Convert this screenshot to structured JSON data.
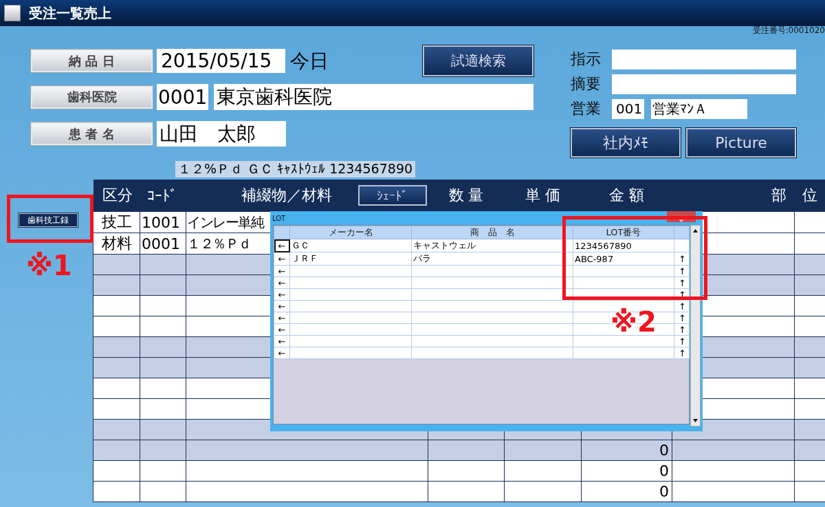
{
  "title_bar": {
    "title": "受注一覧売上",
    "order_number": "受注番号:0001020"
  },
  "form": {
    "delivery_date": {
      "label": "納 品 日",
      "value": "2015/05/15",
      "today": "今日"
    },
    "clinic": {
      "label": "歯科医院",
      "code": "0001",
      "name": "東京歯科医院"
    },
    "patient": {
      "label": "患 者 名",
      "name": "山田　太郎"
    },
    "fitting_search_button": "試適検索",
    "instruction": {
      "label": "指示"
    },
    "summary": {
      "label": "摘要"
    },
    "sales": {
      "label": "営業",
      "code": "001",
      "name": "営業ﾏﾝＡ"
    },
    "buttons": [
      "社内ﾒﾓ",
      "Picture"
    ],
    "info_line": "１２%Ｐｄ ＧＣ ｷｬｽﾄｳｪﾙ 1234567890"
  },
  "side_button": "歯科技工録",
  "table": {
    "columns": [
      "区分",
      "ｺｰﾄﾞ",
      "補綴物／材料",
      "数 量",
      "単 価",
      "金 額",
      "部",
      "位"
    ],
    "shade_button": "ｼｪｰﾄﾞ",
    "rows": [
      {
        "shaded": false,
        "category": "技工",
        "code": "1001",
        "item": "インレー単純"
      },
      {
        "shaded": false,
        "category": "材料",
        "code": "0001",
        "item": "１２％Ｐｄ"
      },
      {
        "shaded": true
      },
      {
        "shaded": true
      },
      {
        "shaded": false
      },
      {
        "shaded": false
      },
      {
        "shaded": true
      },
      {
        "shaded": true
      },
      {
        "shaded": false
      },
      {
        "shaded": false
      },
      {
        "shaded": true
      },
      {
        "shaded": true,
        "amount": "0"
      },
      {
        "shaded": false,
        "amount": "0"
      },
      {
        "shaded": false,
        "amount": "0"
      }
    ]
  },
  "lot_dialog": {
    "title": "LOT",
    "columns": [
      "メーカー名",
      "商　品　名",
      "LOT番号"
    ],
    "rows": [
      {
        "left": "←",
        "selected": true,
        "maker": "ＧＣ",
        "product": "キャストウェル",
        "lot": "1234567890"
      },
      {
        "left": "←",
        "selected": false,
        "maker": "ＪＲＦ",
        "product": "バラ",
        "lot": "ABC-987",
        "up": "↑"
      },
      {
        "left": "←",
        "selected": false,
        "up": "↑"
      },
      {
        "left": "←",
        "selected": false,
        "up": "↑"
      },
      {
        "left": "←",
        "selected": false,
        "up": "↑"
      },
      {
        "left": "←",
        "selected": false,
        "up": "↑"
      },
      {
        "left": "←",
        "selected": false,
        "up": "↑"
      },
      {
        "left": "←",
        "selected": false,
        "up": "↑"
      },
      {
        "left": "←",
        "selected": false,
        "up": "↑"
      },
      {
        "left": "←",
        "selected": false,
        "up": "↑"
      }
    ]
  },
  "annotations": [
    {
      "label": "※1"
    },
    {
      "label": "※2"
    }
  ]
}
